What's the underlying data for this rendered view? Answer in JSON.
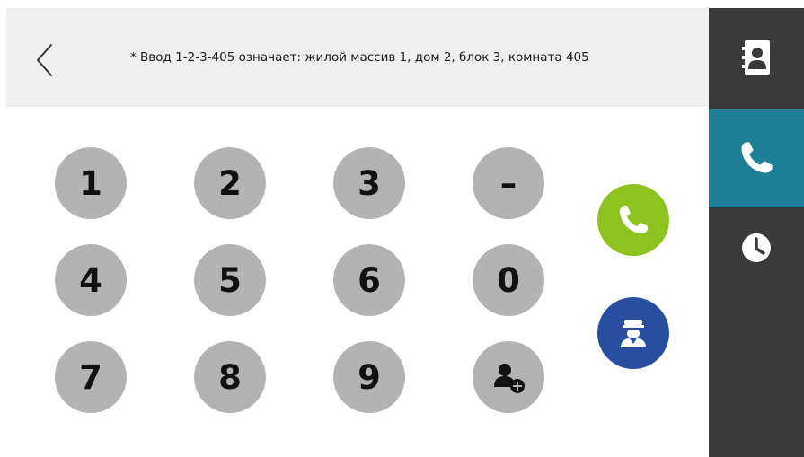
{
  "header": {
    "hint": "* Ввод 1-2-3-405 означает: жилой массив 1, дом 2, блок 3, комната 405",
    "back_icon": "chevron-left-icon"
  },
  "keypad": {
    "keys": [
      {
        "label": "1",
        "name": "key-1"
      },
      {
        "label": "2",
        "name": "key-2"
      },
      {
        "label": "3",
        "name": "key-3"
      },
      {
        "label": "–",
        "name": "key-dash"
      },
      {
        "label": "4",
        "name": "key-4"
      },
      {
        "label": "5",
        "name": "key-5"
      },
      {
        "label": "6",
        "name": "key-6"
      },
      {
        "label": "0",
        "name": "key-0"
      },
      {
        "label": "7",
        "name": "key-7"
      },
      {
        "label": "8",
        "name": "key-8"
      },
      {
        "label": "9",
        "name": "key-9"
      }
    ],
    "add_contact_icon": "add-user-icon",
    "key_color": "#b3b3b3"
  },
  "actions": {
    "call_icon": "phone-icon",
    "call_color": "#8dc21f",
    "guard_icon": "security-guard-icon",
    "guard_color": "#284ea0"
  },
  "sidebar": {
    "items": [
      {
        "name": "contacts",
        "icon": "contact-book-icon",
        "active": false
      },
      {
        "name": "call",
        "icon": "phone-icon",
        "active": true
      },
      {
        "name": "history",
        "icon": "clock-icon",
        "active": false
      }
    ],
    "bg_color": "#3a3a3a",
    "active_color": "#1c7f96"
  }
}
